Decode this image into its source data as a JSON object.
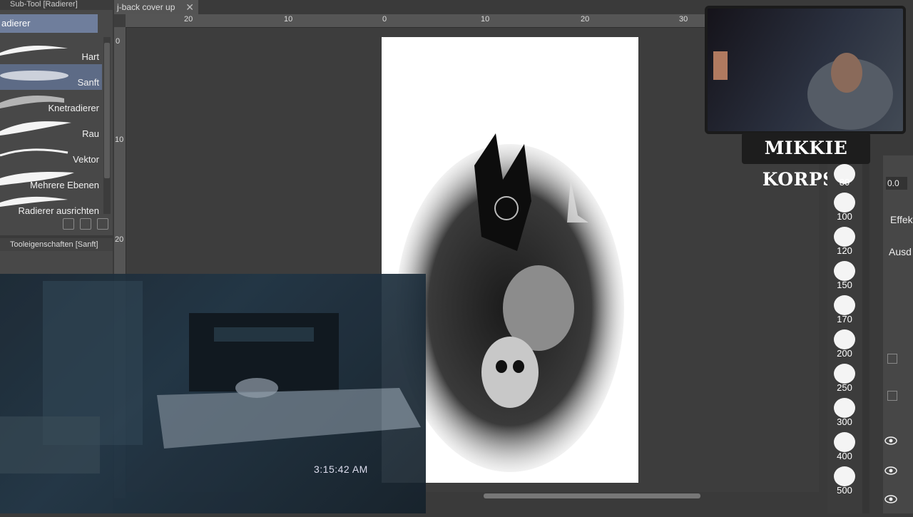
{
  "subtool": {
    "header": "Sub-Tool [Radierer]",
    "group": "adierer",
    "items": [
      {
        "label": "Hart"
      },
      {
        "label": "Sanft",
        "selected": true
      },
      {
        "label": "Knetradierer"
      },
      {
        "label": "Rau"
      },
      {
        "label": "Vektor"
      },
      {
        "label": "Mehrere Ebenen"
      },
      {
        "label": "Radierer ausrichten"
      }
    ]
  },
  "toolprop": {
    "header": "Tooleigenschaften [Sanft]"
  },
  "document": {
    "tab_title": "j-back cover up",
    "ruler_top": [
      "20",
      "10",
      "0",
      "10",
      "20",
      "30"
    ],
    "ruler_left": [
      "0",
      "10",
      "20"
    ]
  },
  "video": {
    "timestamp": "3:15:42 AM"
  },
  "webcam": {
    "name": "MIKKIE KORPSE"
  },
  "brush_sizes": [
    "80",
    "100",
    "120",
    "150",
    "170",
    "200",
    "250",
    "300",
    "400",
    "500"
  ],
  "layer_panel": {
    "opacity": "0.0",
    "effect_label": "Effek",
    "expression_label": "Ausd"
  },
  "colors": {
    "accent": "#6f7e9c",
    "selected_item": "#5d6b86",
    "panel": "#484848",
    "canvas_bg": "#3d3d3d"
  }
}
